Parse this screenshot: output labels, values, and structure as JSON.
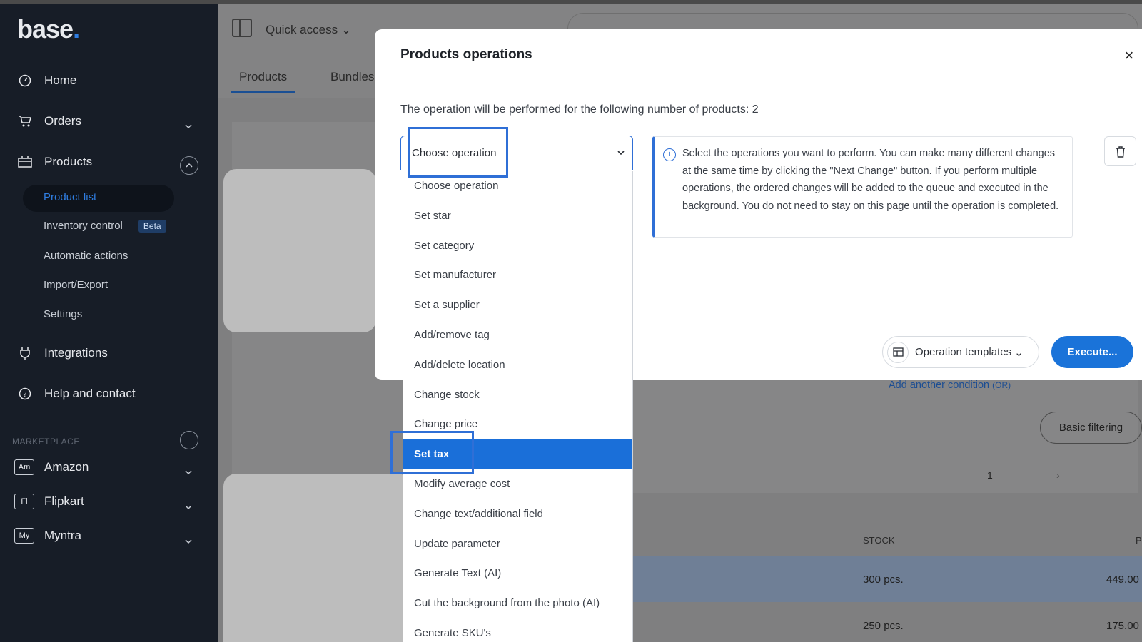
{
  "sidebar": {
    "logo": "base",
    "logo_dot": ".",
    "nav": [
      {
        "label": "Home",
        "icon": "dashboard-icon"
      },
      {
        "label": "Orders",
        "icon": "cart-icon"
      },
      {
        "label": "Products",
        "icon": "products-icon"
      },
      {
        "label": "Integrations",
        "icon": "plug-icon"
      },
      {
        "label": "Help and contact",
        "icon": "help-icon"
      }
    ],
    "products_sub": [
      {
        "label": "Product list"
      },
      {
        "label": "Inventory control",
        "badge": "Beta"
      },
      {
        "label": "Automatic actions"
      },
      {
        "label": "Import/Export"
      },
      {
        "label": "Settings"
      }
    ],
    "marketplace_label": "MARKETPLACE",
    "marketplaces": [
      {
        "abbr": "Am",
        "label": "Amazon"
      },
      {
        "abbr": "Fl",
        "label": "Flipkart"
      },
      {
        "abbr": "My",
        "label": "Myntra"
      }
    ]
  },
  "header": {
    "quick_access": "Quick access",
    "tabs": [
      "Products",
      "Bundles"
    ]
  },
  "modal": {
    "title": "Products operations",
    "description": "The operation will be performed for the following number of products: 2",
    "select_value": "Choose operation",
    "info_text": "Select the operations you want to perform. You can make many different changes at the same time by clicking the \"Next Change\" button. If you perform multiple operations, the ordered changes will be added to the queue and executed in the background. You do not need to stay on this page until the operation is completed.",
    "templates_button": "Operation templates",
    "execute_button": "Execute..."
  },
  "dropdown": {
    "options": [
      "Choose operation",
      "Set star",
      "Set category",
      "Set manufacturer",
      "Set a supplier",
      "Add/remove tag",
      "Add/delete location",
      "Change stock",
      "Change price",
      "Set tax",
      "Modify average cost",
      "Change text/additional field",
      "Update parameter",
      "Generate Text (AI)",
      "Cut the background from the photo (AI)",
      "Generate SKU's"
    ],
    "selected": "Set tax"
  },
  "page": {
    "add_condition": "Add another condition",
    "add_condition_suffix": "(OR)",
    "basic_filtering": "Basic filtering",
    "page_number": "1",
    "columns": {
      "stock": "STOCK",
      "price_partial": "P"
    },
    "rows": [
      {
        "stock": "300 pcs.",
        "price": "449.00"
      },
      {
        "stock": "250 pcs.",
        "price": "175.00"
      }
    ]
  },
  "colors": {
    "accent": "#1a73d9",
    "sidebar_bg": "#171d27",
    "selected_option": "#1a6fd9"
  }
}
